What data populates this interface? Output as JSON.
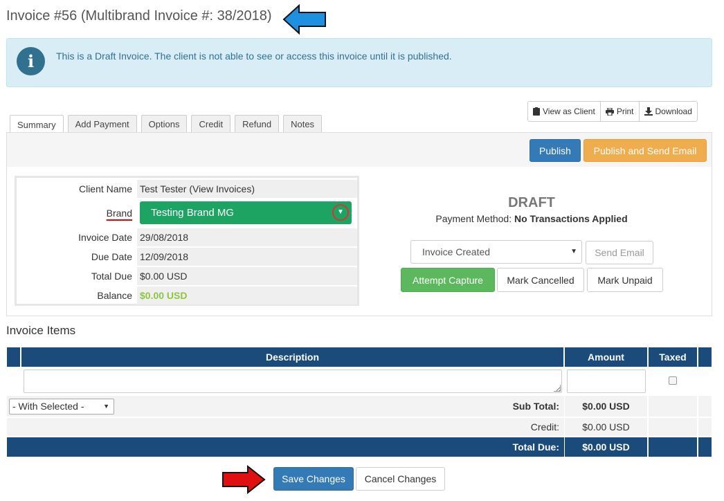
{
  "header": {
    "title": "Invoice #56 (Multibrand Invoice #: 38/2018)"
  },
  "alert": {
    "icon": "info-icon",
    "text": "This is a Draft Invoice. The client is not able to see or access this invoice until it is published."
  },
  "toolbar": {
    "view_as_client": "View as Client",
    "print": "Print",
    "download": "Download"
  },
  "tabs": [
    "Summary",
    "Add Payment",
    "Options",
    "Credit",
    "Refund",
    "Notes"
  ],
  "actions": {
    "publish": "Publish",
    "publish_send": "Publish and Send Email"
  },
  "client": {
    "client_name_label": "Client Name",
    "client_name": "Test Tester (View Invoices)",
    "brand_label": "Brand",
    "brand_value": "Testing Brand MG",
    "invoice_date_label": "Invoice Date",
    "invoice_date": "29/08/2018",
    "due_date_label": "Due Date",
    "due_date": "12/09/2018",
    "total_due_label": "Total Due",
    "total_due": "$0.00 USD",
    "balance_label": "Balance",
    "balance": "$0.00 USD"
  },
  "status": {
    "title": "DRAFT",
    "payment_method_label": "Payment Method:",
    "payment_method_value": "No Transactions Applied",
    "email_template": "Invoice Created",
    "send_email": "Send Email",
    "attempt_capture": "Attempt Capture",
    "mark_cancelled": "Mark Cancelled",
    "mark_unpaid": "Mark Unpaid"
  },
  "items": {
    "title": "Invoice Items",
    "columns": {
      "description": "Description",
      "amount": "Amount",
      "taxed": "Taxed"
    },
    "with_selected": "- With Selected -",
    "subtotal_label": "Sub Total:",
    "subtotal": "$0.00 USD",
    "credit_label": "Credit:",
    "credit": "$0.00 USD",
    "total_due_label": "Total Due:",
    "total_due": "$0.00 USD"
  },
  "footer": {
    "save": "Save Changes",
    "cancel": "Cancel Changes"
  },
  "colors": {
    "primary": "#337ab7",
    "warning": "#f0ad4e",
    "success": "#5cb85c",
    "brand_select": "#1ea462",
    "table_header": "#1b4b7a",
    "annotation_blue_arrow": "#1e90e0",
    "annotation_red_arrow": "#e01010"
  }
}
